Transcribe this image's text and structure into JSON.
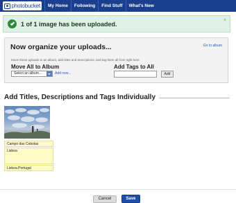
{
  "header": {
    "logo_text": "photobucket",
    "nav": [
      "My Home",
      "Following",
      "Find Stuff",
      "What's New"
    ]
  },
  "banner": {
    "message": "1 of 1 image has been uploaded.",
    "close_icon": "×"
  },
  "organize": {
    "title": "Now organize your uploads...",
    "goto_link": "Go to album",
    "description": "Move these uploads to an album, add titles and descriptions, and tag them all from right here.",
    "move_heading": "Move All to Album",
    "album_select_value": "Select an album...",
    "add_new_link": "Add new...",
    "tags_heading": "Add Tags to All",
    "tags_input_value": "",
    "add_button": "Add"
  },
  "individual": {
    "heading": "Add Titles, Descriptions and Tags Individually",
    "items": [
      {
        "title": "Campo das Cebolas",
        "description": "Lisboa",
        "tags": "Lisboa Portugal"
      }
    ]
  },
  "footer": {
    "cancel_button": "Cancel",
    "save_button": "Save"
  },
  "colors": {
    "nav_bg": "#1b3f8f",
    "banner_bg": "#dff0e6",
    "success_check": "#2e8b3a",
    "field_bg": "#fffbc7",
    "save_bg": "#1d4fa8",
    "link": "#2a56b8"
  },
  "icons": {
    "logo": "photobucket-logo-icon",
    "success": "check-circle-icon",
    "close": "close-icon",
    "select_arrow": "chevron-down-icon"
  }
}
